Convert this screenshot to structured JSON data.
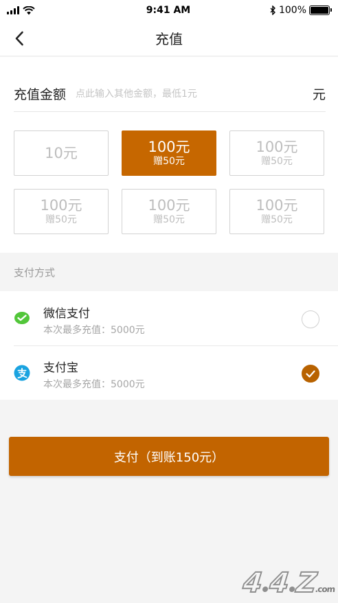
{
  "status_bar": {
    "time": "9:41 AM",
    "battery_text": "100%",
    "battery_level": 1.0,
    "icons": [
      "signal-icon",
      "wifi-icon",
      "bluetooth-icon",
      "battery-icon"
    ]
  },
  "nav": {
    "title": "充值",
    "back_icon": "chevron-left-icon"
  },
  "amount": {
    "label": "充值金额",
    "placeholder": "点此输入其他金额，最低1元",
    "value": "",
    "unit": "元"
  },
  "options": [
    {
      "amount": "10元",
      "bonus": "",
      "selected": false
    },
    {
      "amount": "100元",
      "bonus": "赠50元",
      "selected": true
    },
    {
      "amount": "100元",
      "bonus": "赠50元",
      "selected": false
    },
    {
      "amount": "100元",
      "bonus": "赠50元",
      "selected": false
    },
    {
      "amount": "100元",
      "bonus": "赠50元",
      "selected": false
    },
    {
      "amount": "100元",
      "bonus": "赠50元",
      "selected": false
    }
  ],
  "payment": {
    "header": "支付方式",
    "methods": [
      {
        "name": "微信支付",
        "limit": "本次最多充值：5000元",
        "icon": "wechat-pay-icon",
        "selected": false
      },
      {
        "name": "支付宝",
        "limit": "本次最多充值：5000元",
        "icon": "alipay-icon",
        "selected": true
      }
    ]
  },
  "pay_button": {
    "label": "支付（到账150元）"
  },
  "watermark": {
    "text": "4O4OZ",
    "domain": ".com"
  },
  "colors": {
    "accent": "#c66700",
    "wechat_green": "#52c63a",
    "alipay_blue": "#1aa3e0",
    "placeholder": "#c4c4c4",
    "background": "#f4f4f4"
  }
}
